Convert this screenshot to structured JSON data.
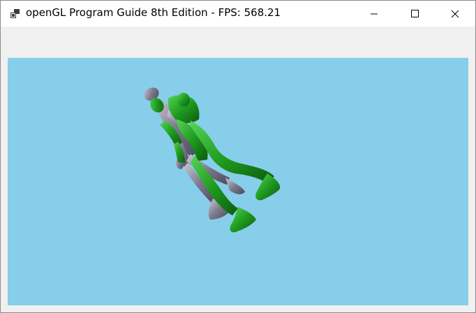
{
  "window": {
    "title": "openGL Program Guide 8th Edition - FPS: 568.21"
  },
  "controls": {
    "minimize_icon": "minimize-icon",
    "maximize_icon": "maximize-icon",
    "close_icon": "close-icon"
  },
  "viewport": {
    "background": "#87ceeb",
    "figures": [
      {
        "name": "green-figure",
        "color": "#2faa2f"
      },
      {
        "name": "silver-figure",
        "color": "#8a8a9a"
      }
    ]
  }
}
